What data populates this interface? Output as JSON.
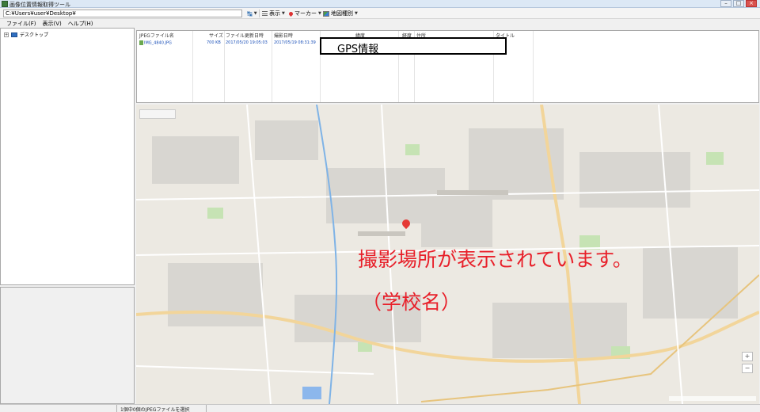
{
  "window": {
    "title": "画像位置情報取得ツール"
  },
  "toolbar": {
    "path_value": "C:¥Users¥user¥Desktop¥",
    "display_label": "表示",
    "marker_label": "マーカー",
    "map_type_label": "地図種別"
  },
  "menu": [
    {
      "label": "ファイル(F)"
    },
    {
      "label": "表示(V)"
    },
    {
      "label": "ヘルプ(H)"
    }
  ],
  "tree": {
    "root_label": "デスクトップ",
    "expand_glyph": "+"
  },
  "file_list": {
    "columns": [
      "JPEGファイル名",
      "サイズ",
      "ファイル更新日時",
      "撮影日時",
      "緯度",
      "経度",
      "住所",
      "タイトル"
    ],
    "rows": [
      {
        "name": "IMG_4840.JPG",
        "size": "700 KB",
        "modified": "2017/05/20 19:05:03",
        "taken": "2017/05/19 08:31:39"
      }
    ]
  },
  "annotations": {
    "gps_label": "GPS情報",
    "location_caption": "撮影場所が表示されています。",
    "school_caption": "（学校名）"
  },
  "map": {
    "zoom_in": "+",
    "zoom_out": "−",
    "marker_color": "#e53935"
  },
  "status": {
    "text": "1個中0個のJPEGファイルを選択"
  },
  "colors": {
    "annotation_red": "#e8202a",
    "link_blue": "#1a4fb8",
    "title_bar": "#dce8f5"
  }
}
